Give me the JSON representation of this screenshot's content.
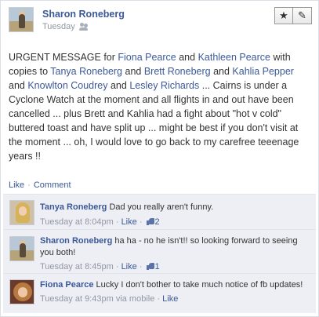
{
  "post": {
    "author": "Sharon Roneberg",
    "time": "Tuesday",
    "privacy_icon": "friends-icon",
    "buttons": [
      {
        "icon": "star-icon",
        "glyph": "★"
      },
      {
        "icon": "pencil-icon",
        "glyph": "✎"
      }
    ],
    "text": {
      "p1": "URGENT MESSAGE for ",
      "n1": "Fiona Pearce",
      "p2": " and ",
      "n2": "Kathleen Pearce",
      "p3": " with copies to ",
      "n3": "Tanya Roneberg",
      "p4": " and ",
      "n4": "Brett Roneberg",
      "p5": " and ",
      "n5": "Kahlia Pepper",
      "p6": " and ",
      "n6": "Knowlton Coudrey",
      "p7": " and ",
      "n7": "Lesley Richards",
      "p8": " ... Cairns is under a Cyclone Watch at the moment and all flights in and out have been cancelled ... plus Brett and Kahlia had a fight about \"hot v cold\" buttered toast and have split up ... might be best if you don't visit at the moment ... oh, I would love to go back to my carefree teeenage years !!"
    },
    "actions": {
      "like": "Like",
      "separator": "·",
      "comment": "Comment"
    }
  },
  "comments": [
    {
      "author": "Tanya Roneberg",
      "text": "Dad you really aren't funny.",
      "time": "Tuesday at 8:04pm",
      "separator": "·",
      "like": "Like",
      "like_count": "2"
    },
    {
      "author": "Sharon Roneberg",
      "text": "ha ha - no he isn't!! so looking forward to seeing you both!",
      "time": "Tuesday at 8:45pm",
      "separator": "·",
      "like": "Like",
      "like_count": "1"
    },
    {
      "author": "Fiona Pearce",
      "text": "Lucky I don't bother to take much notice of fb updates!",
      "time": "Tuesday at 9:43pm via mobile",
      "separator": "·",
      "like": "Like"
    }
  ],
  "colors": {
    "link": "#3b5998",
    "meta": "#9197a3",
    "comments_bg": "#edeff4"
  }
}
